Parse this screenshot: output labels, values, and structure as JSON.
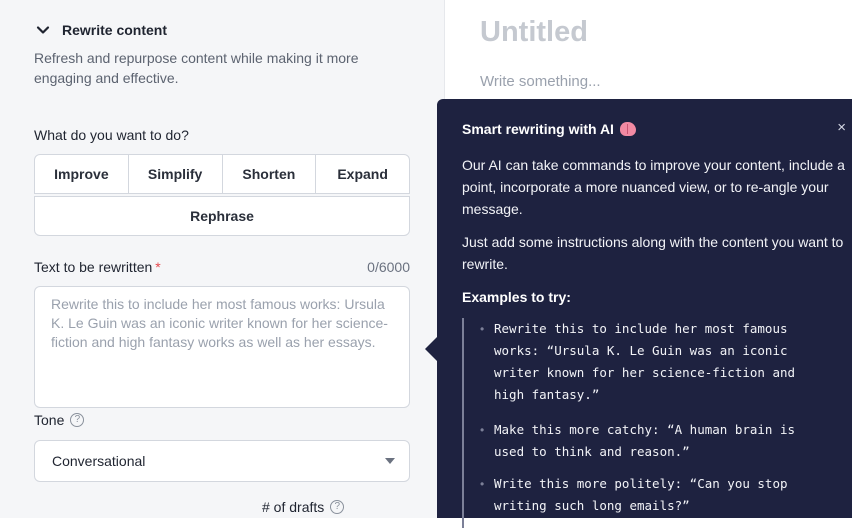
{
  "section": {
    "title": "Rewrite content",
    "description": "Refresh and repurpose content while making it more engaging and effective."
  },
  "action": {
    "question": "What do you want to do?",
    "options": [
      "Improve",
      "Simplify",
      "Shorten",
      "Expand"
    ],
    "extra_option": "Rephrase"
  },
  "text_field": {
    "label": "Text to be rewritten",
    "required_mark": "*",
    "counter": "0/6000",
    "placeholder": "Rewrite this to include her most famous works: Ursula K. Le Guin was an iconic writer known for her science-fiction and high fantasy works as well as her essays."
  },
  "tone": {
    "label": "Tone",
    "help": "?",
    "selected": "Conversational"
  },
  "drafts": {
    "label": "# of drafts",
    "help": "?"
  },
  "editor": {
    "title": "Untitled",
    "placeholder": "Write something..."
  },
  "tooltip": {
    "title": "Smart rewriting with AI",
    "icon": "brain-icon",
    "close": "×",
    "p1": "Our AI can take commands to improve your content, include a point, incorporate a more nuanced view, or to re-angle your message.",
    "p2": "Just add some instructions along with the content you want to rewrite.",
    "examples_heading": "Examples to try:",
    "examples": [
      "Rewrite this to include her most famous\nworks: “Ursula K. Le Guin was an iconic\nwriter known for her science-fiction and\nhigh fantasy.”",
      "Make this more catchy: “A human brain is\nused to think and reason.”",
      "Write this more politely: “Can you stop\nwriting such long emails?”"
    ]
  },
  "colors": {
    "panel_bg": "#f5f6f8",
    "tooltip_bg": "#1e2240",
    "required": "#e5484d"
  }
}
